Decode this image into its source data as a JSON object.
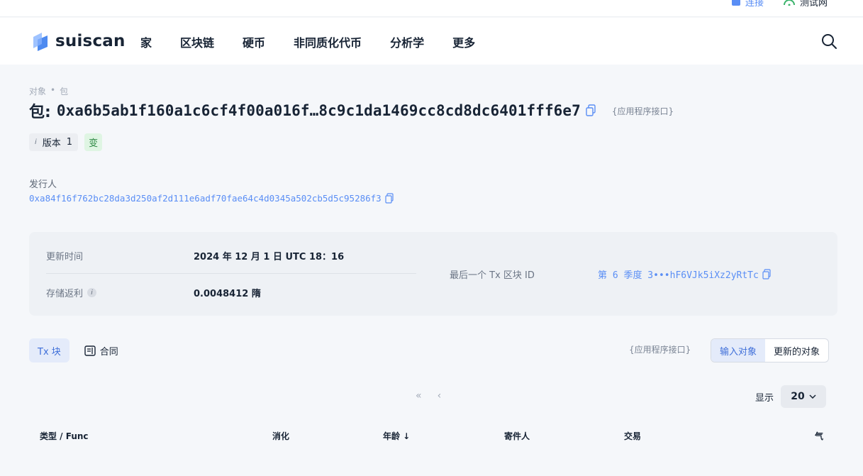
{
  "topbar": {
    "connect_label": "连接",
    "network_label": "测试网"
  },
  "nav": {
    "brand": "suiscan",
    "items": [
      "家",
      "区块链",
      "硬币",
      "非同质化代币",
      "分析学",
      "更多"
    ]
  },
  "breadcrumb": {
    "first": "对象",
    "sep": "•",
    "second": "包"
  },
  "header": {
    "label": "包:",
    "address": "0xa6b5ab1f160a1c6cf4f00a016f…8c9c1da1469cc8cd8dc6401fff6e7",
    "api_tag": "{应用程序接口}"
  },
  "badges": {
    "info_glyph": "i",
    "version_label": "版本",
    "version_value": "1",
    "mutable_label": "变"
  },
  "publisher": {
    "label": "发行人",
    "address": "0xa84f16f762bc28da3d250af2d111e6adf70fae64c4d0345a502cb5d5c95286f3"
  },
  "details": {
    "updated_label": "更新时间",
    "updated_value": "2024 年 12 月 1 日 UTC 18：16",
    "rebate_label": "存储返利",
    "rebate_value": "0.0048412 隋",
    "last_tx_label": "最后一个 Tx 区块 ID",
    "last_tx_value": "第 6 季度 3•••hF6VJk5iXz2yRtTc"
  },
  "tabs": {
    "txblocks": "Tx 块",
    "contract": "合同"
  },
  "filters": {
    "api_tag": "{应用程序接口}",
    "input_objects": "输入对象",
    "updated_objects": "更新的对象"
  },
  "pagination": {
    "first": "«",
    "prev": "‹",
    "show_label": "显示",
    "page_size": "20"
  },
  "table": {
    "columns": [
      "类型 / Func",
      "消化",
      "年龄 ↓",
      "寄件人",
      "交易",
      "气"
    ]
  },
  "colors": {
    "accent": "#5a8ef5",
    "active_tab_bg": "#e4ebfa",
    "mutable_green": "#2f8a45",
    "page_bg": "#f5f7fa"
  }
}
